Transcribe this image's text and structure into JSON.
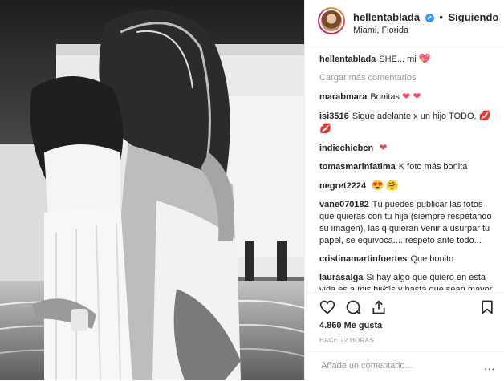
{
  "post": {
    "username": "hellentablada",
    "follow_label": "Siguiendo",
    "location": "Miami, Florida",
    "likes": "4.860 Me gusta",
    "time": "HACE 22 HORAS"
  },
  "caption": {
    "user": "hellentablada",
    "text": "SHE... mi",
    "emoji": "💖"
  },
  "load_more": "Cargar más comentarios",
  "comments": [
    {
      "user": "marabmara",
      "text": "Bonitas",
      "emoji": "❤ ❤"
    },
    {
      "user": "isi3516",
      "text": "Sigue adelante x un hijo TODO.",
      "emoji": "💋 💋"
    },
    {
      "user": "indiechicbcn",
      "text": "",
      "emoji": "❤"
    },
    {
      "user": "tomasmarinfatima",
      "text": "K foto más bonita",
      "emoji": ""
    },
    {
      "user": "negret2224",
      "text": "",
      "emoji": "😍 🤗"
    },
    {
      "user": "vane070182",
      "text": "Tú puedes publicar las fotos que quieras con tu hija (siempre respetando su imagen), las q quieran venir a usurpar tu papel, se equivoca.... respeto ante todo...",
      "emoji": ""
    },
    {
      "user": "cristinamartinfuertes",
      "text": "Que bonito",
      "emoji": ""
    },
    {
      "user": "laurasalga",
      "text": "Si hay algo que quiero en esta vida es a mis hij@s,y hasta que sean mayor d edad(uno ya lo es) soy yo la",
      "emoji": ""
    }
  ],
  "add_comment": {
    "placeholder": "Añade un comentario...",
    "more": "..."
  },
  "icons": {
    "like": "heart-outline-icon",
    "comment": "comment-icon",
    "share": "share-icon",
    "save": "bookmark-icon",
    "verified": "verified-badge-icon"
  }
}
